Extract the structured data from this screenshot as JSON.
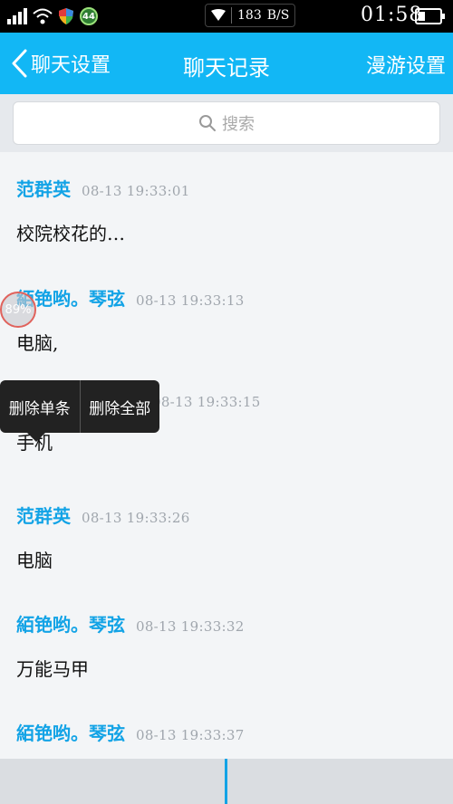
{
  "status_bar": {
    "network_rate": "183",
    "network_unit": "B/S",
    "notification_badge": "44",
    "time": "01:58",
    "icons": [
      "signal-icon",
      "wifi-icon",
      "shield-icon",
      "badge-icon",
      "battery-icon"
    ]
  },
  "header": {
    "back_label": "聊天设置",
    "title": "聊天记录",
    "right_label": "漫游设置",
    "color": "#12b7f5"
  },
  "search": {
    "placeholder": "搜索"
  },
  "messages": [
    {
      "sender": "范群英",
      "time": "08-13  19:33:01",
      "text": "校院校花的…"
    },
    {
      "sender": "絔铯哟。琴弦",
      "time": "08-13  19:33:13",
      "text": "电脑,"
    },
    {
      "sender": "",
      "time": "08-13  19:33:15",
      "text": "手机"
    },
    {
      "sender": "范群英",
      "time": "08-13  19:33:26",
      "text": "电脑"
    },
    {
      "sender": "絔铯哟。琴弦",
      "time": "08-13  19:33:32",
      "text": "万能马甲"
    },
    {
      "sender": "絔铯哟。琴弦",
      "time": "08-13  19:33:37",
      "text": ""
    }
  ],
  "context_menu": {
    "delete_single": "删除单条",
    "delete_all": "删除全部"
  },
  "floating_ball": {
    "percent": "89%"
  },
  "colors": {
    "accent": "#12b7f5",
    "sender": "#12a3e6"
  }
}
